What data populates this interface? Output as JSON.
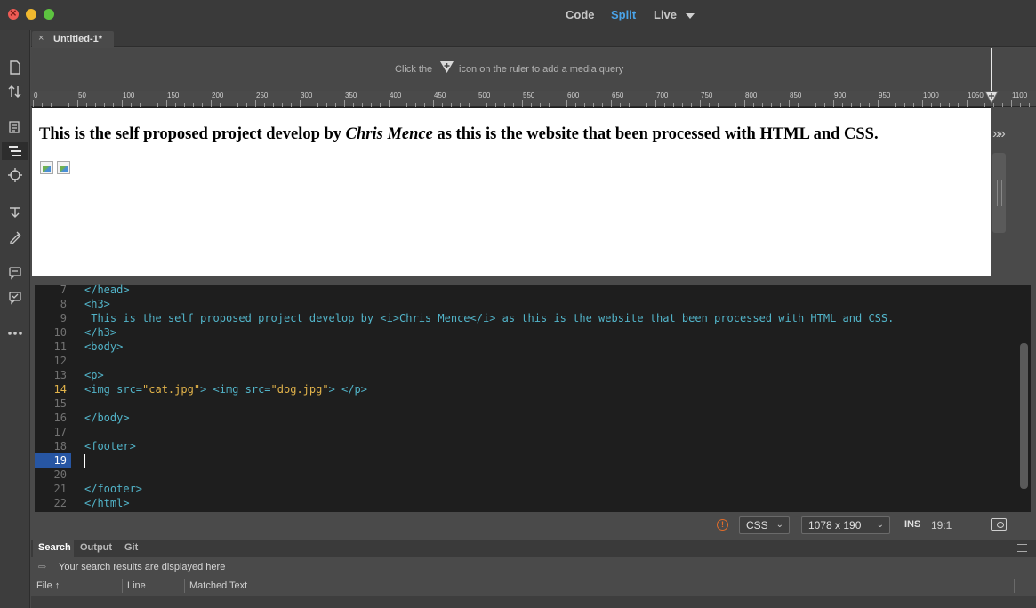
{
  "titlebar": {
    "modes": {
      "code": "Code",
      "split": "Split",
      "live": "Live"
    }
  },
  "document_tab": {
    "close": "×",
    "name": "Untitled-1*"
  },
  "media_query": {
    "text_before": "Click the",
    "text_after": "icon on the ruler to add a media query"
  },
  "ruler": {
    "labels": [
      "0",
      "50",
      "100",
      "150",
      "200",
      "250",
      "300",
      "350",
      "400",
      "450",
      "500",
      "550",
      "600",
      "650",
      "700",
      "750",
      "800",
      "850",
      "900",
      "950",
      "1000",
      "1050",
      "1100"
    ]
  },
  "live_view": {
    "heading_before": "This is the self proposed project develop by ",
    "heading_italic": "Chris Mence",
    "heading_after": " as this is the website that been processed with HTML and CSS.",
    "chevrons": "»»"
  },
  "code": {
    "lines": [
      {
        "n": "7",
        "tokens": [
          [
            "tag",
            "</head>"
          ]
        ]
      },
      {
        "n": "8",
        "tokens": [
          [
            "tag",
            "<h3>"
          ]
        ]
      },
      {
        "n": "9",
        "tokens": [
          [
            "txt",
            " This is the self proposed project develop by "
          ],
          [
            "tag",
            "<i>"
          ],
          [
            "txt",
            "Chris Mence"
          ],
          [
            "tag",
            "</i>"
          ],
          [
            "txt",
            " as this is the website that been processed with HTML and CSS."
          ]
        ]
      },
      {
        "n": "10",
        "tokens": [
          [
            "tag",
            "</h3>"
          ]
        ]
      },
      {
        "n": "11",
        "tokens": [
          [
            "tag",
            "<body>"
          ]
        ]
      },
      {
        "n": "12",
        "tokens": []
      },
      {
        "n": "13",
        "tokens": [
          [
            "tag",
            "<p>"
          ]
        ]
      },
      {
        "n": "14",
        "tokens": [
          [
            "tag",
            "<img src="
          ],
          [
            "str",
            "\"cat.jpg\""
          ],
          [
            "tag",
            "> <img src="
          ],
          [
            "str",
            "\"dog.jpg\""
          ],
          [
            "tag",
            "> </p>"
          ]
        ]
      },
      {
        "n": "15",
        "tokens": []
      },
      {
        "n": "16",
        "tokens": [
          [
            "tag",
            "</body>"
          ]
        ]
      },
      {
        "n": "17",
        "tokens": []
      },
      {
        "n": "18",
        "tokens": [
          [
            "tag",
            "<footer>"
          ]
        ]
      },
      {
        "n": "19",
        "tokens": []
      },
      {
        "n": "20",
        "tokens": []
      },
      {
        "n": "21",
        "tokens": [
          [
            "tag",
            "</footer>"
          ]
        ]
      },
      {
        "n": "22",
        "tokens": [
          [
            "tag",
            "</html>"
          ]
        ]
      }
    ],
    "highlight_line": "14",
    "selected_line": "19"
  },
  "statusbar": {
    "warning": "!",
    "language": "CSS",
    "size": "1078 x 190",
    "mode": "INS",
    "position": "19:1"
  },
  "panel": {
    "tabs": [
      "Search",
      "Output",
      "Git"
    ],
    "result_icon": "⇨",
    "results_text": "Your search results are displayed here",
    "columns": {
      "file": "File",
      "sort_arrow": "↑",
      "line": "Line",
      "matched": "Matched Text"
    }
  },
  "colors": {
    "accent": "#4aa3e8",
    "code_bg": "#1e1e1e",
    "code_tag": "#52b4c9",
    "code_string": "#e2b34a",
    "selected_line_bg": "#2756a3",
    "warning": "#e06c2a"
  }
}
